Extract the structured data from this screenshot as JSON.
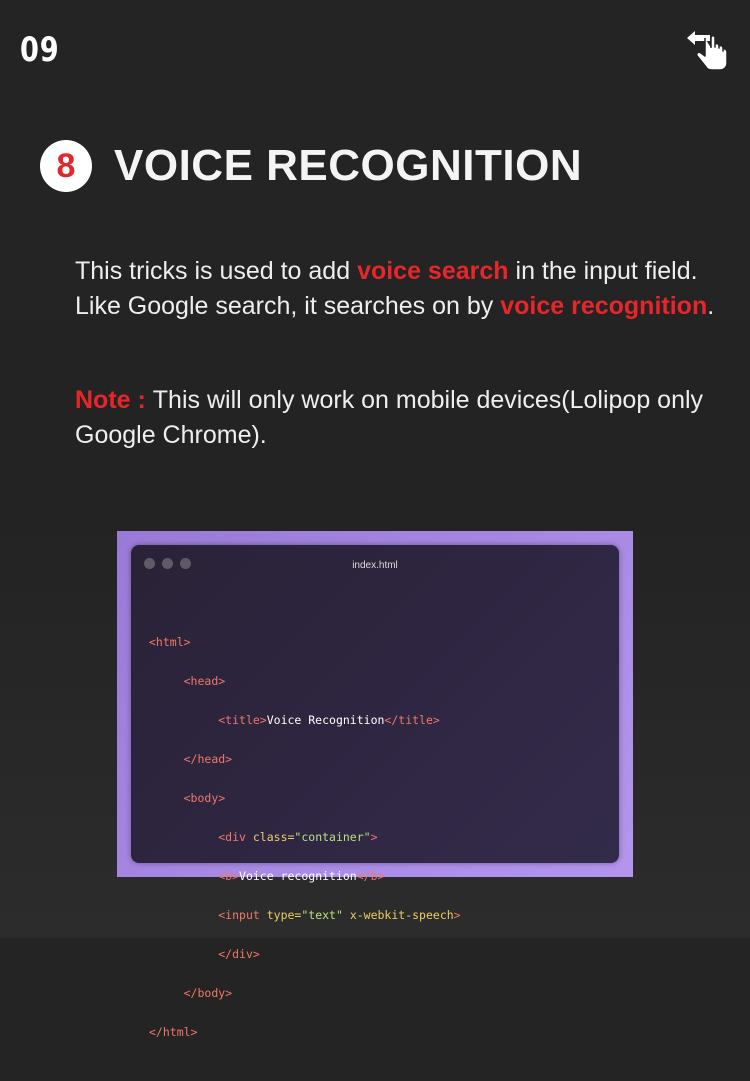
{
  "page_number": "09",
  "heading": {
    "number": "8",
    "title": "VOICE RECOGNITION"
  },
  "paragraph1": {
    "part1": "This tricks is used to add ",
    "highlight1": "voice search",
    "part2": " in the input field. Like Google search, it searches on by ",
    "highlight2": "voice recognition",
    "part3": "."
  },
  "note": {
    "label": "Note : ",
    "text": "This will only work on mobile devices(Lolipop only Google Chrome)."
  },
  "code_window": {
    "filename": "index.html",
    "lines": {
      "l1": "<html>",
      "l2": "<head>",
      "l3_open": "<title>",
      "l3_text": "Voice Recognition",
      "l3_close": "</title>",
      "l4": "</head>",
      "l5": "<body>",
      "l6_open": "<div ",
      "l6_attr": "class=",
      "l6_val": "\"container\"",
      "l6_close": ">",
      "l7_open": "<b>",
      "l7_text": "Voice recognition",
      "l7_close": "</b>",
      "l8_open": "<input ",
      "l8_attr1": "type=",
      "l8_val": "\"text\"",
      "l8_attr2": " x-webkit-speech",
      "l8_close": ">",
      "l9": "</div>",
      "l10": "</body>",
      "l11": "</html>"
    }
  },
  "colors": {
    "accent": "#e8262a",
    "background": "#232323",
    "frame": "#a98ae6"
  },
  "icons": {
    "swipe": "swipe-left-hand-icon"
  }
}
